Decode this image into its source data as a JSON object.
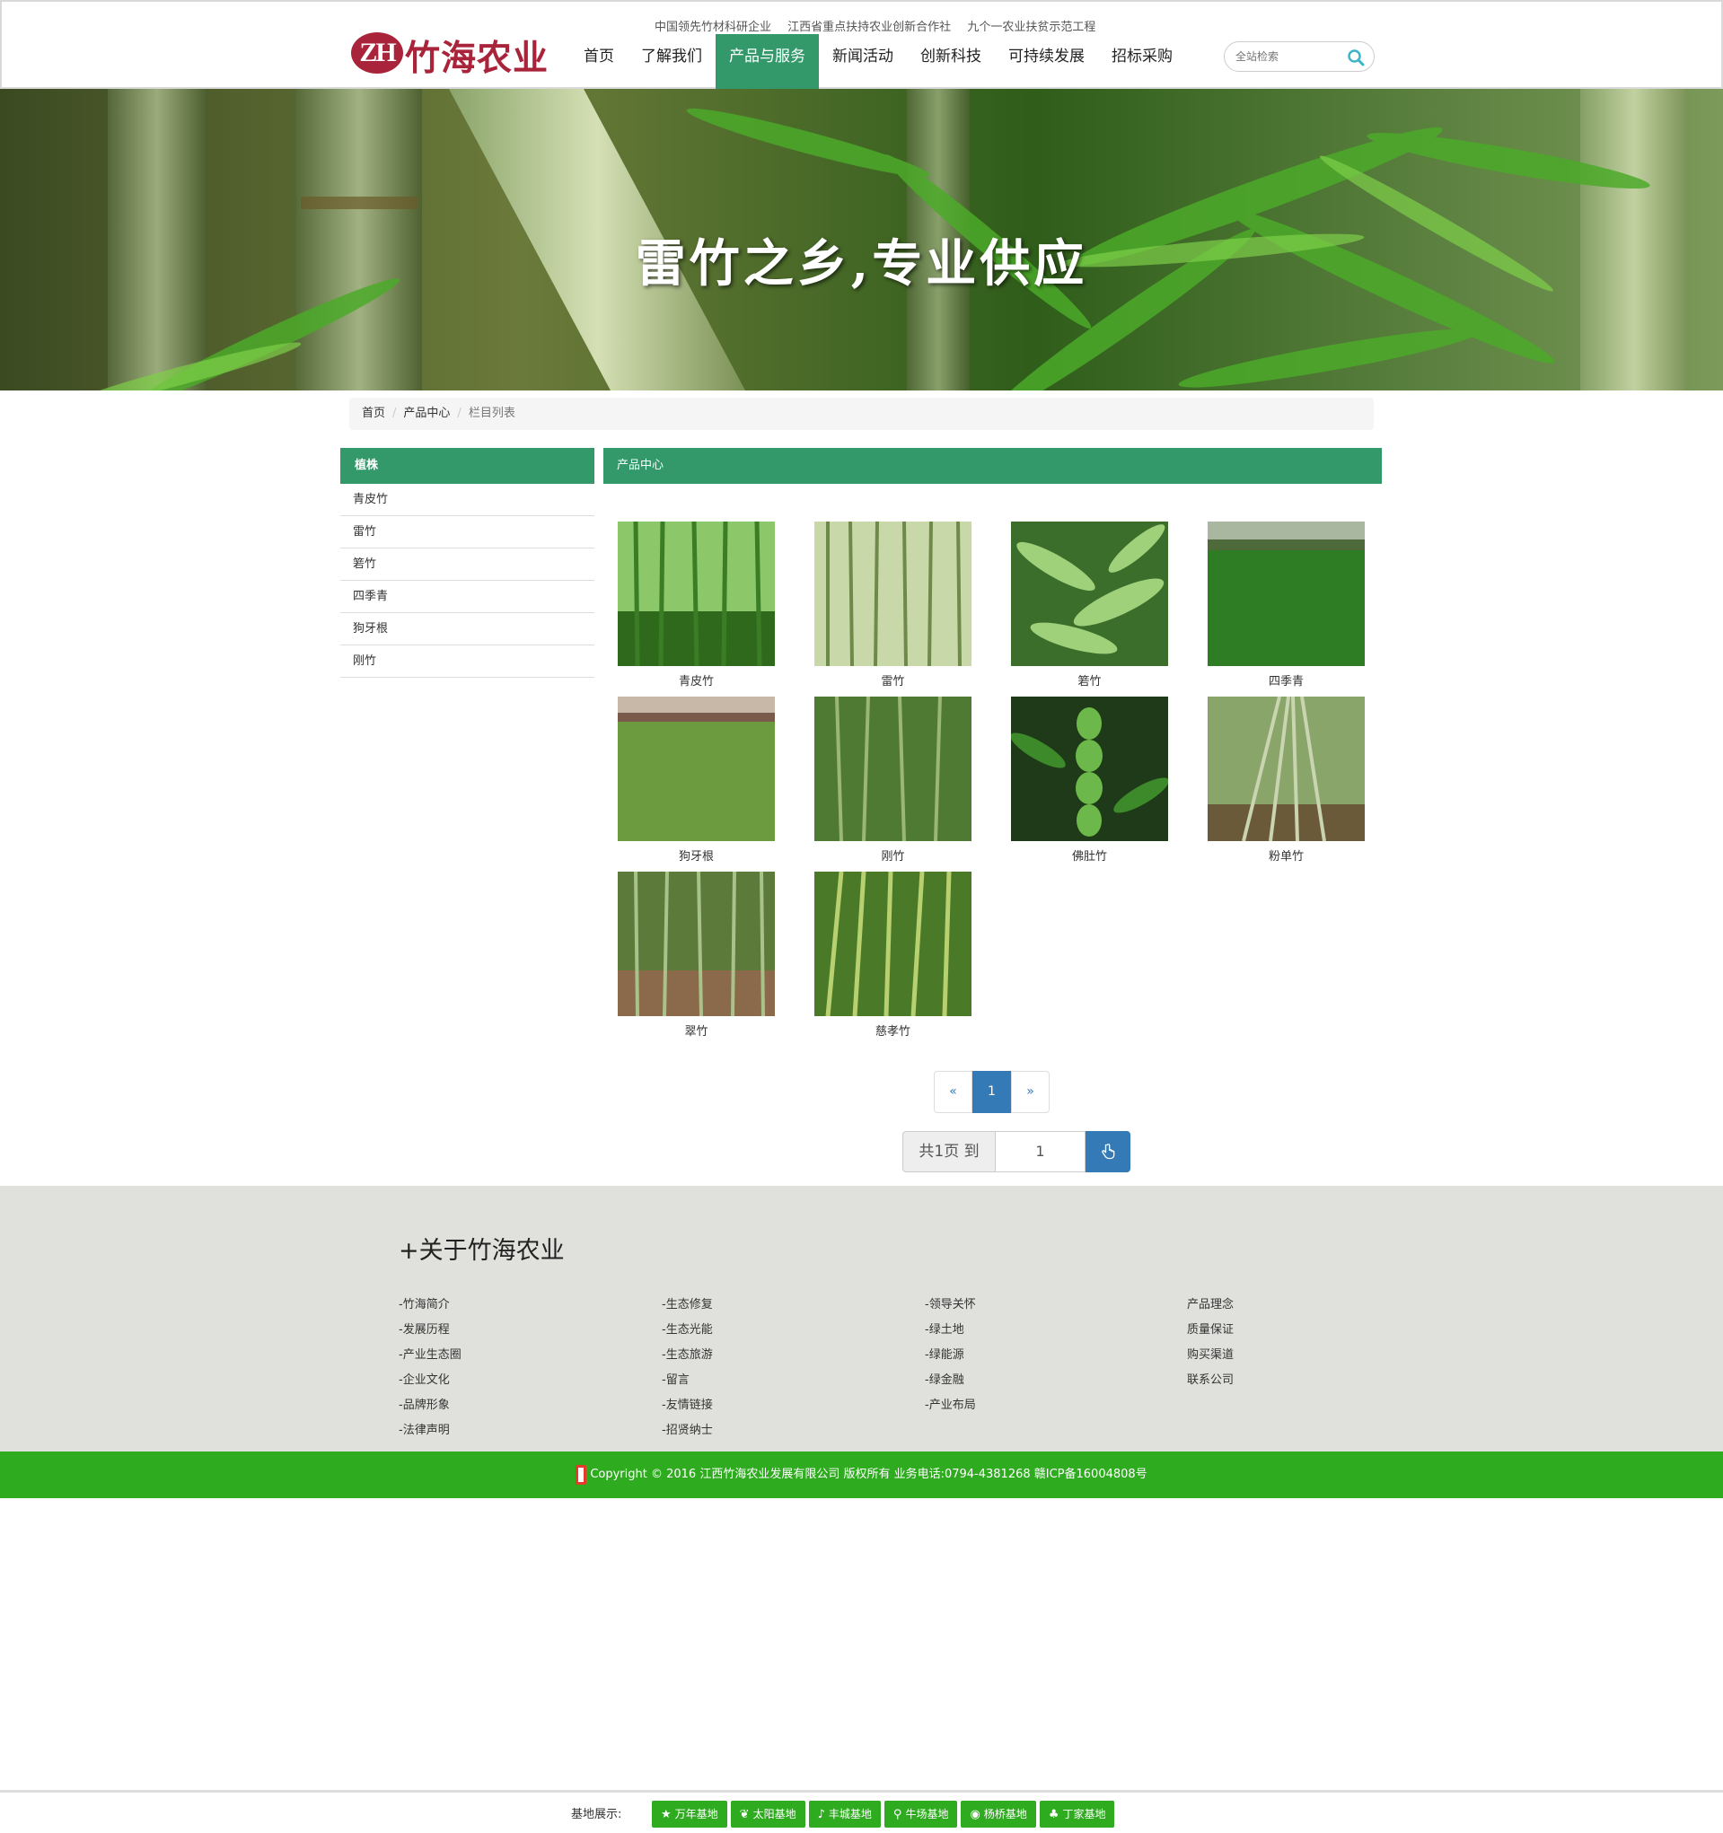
{
  "header": {
    "logo_abbr": "ZH",
    "logo_text": "竹海农业",
    "taglines": [
      "中国领先竹材科研企业",
      "江西省重点扶持农业创新合作社",
      "九个一农业扶贫示范工程"
    ],
    "nav": [
      "首页",
      "了解我们",
      "产品与服务",
      "新闻活动",
      "创新科技",
      "可持续发展",
      "招标采购"
    ],
    "active_nav": "产品与服务",
    "search_placeholder": "全站检索"
  },
  "banner": {
    "slogan": "雷竹之乡,专业供应"
  },
  "breadcrumb": [
    "首页",
    "产品中心",
    "栏目列表"
  ],
  "sidebar": {
    "title": "植株",
    "items": [
      "青皮竹",
      "雷竹",
      "箬竹",
      "四季青",
      "狗牙根",
      "刚竹"
    ]
  },
  "main": {
    "title": "产品中心",
    "products": [
      {
        "name": "青皮竹"
      },
      {
        "name": "雷竹"
      },
      {
        "name": "箬竹"
      },
      {
        "name": "四季青"
      },
      {
        "name": "狗牙根"
      },
      {
        "name": "刚竹"
      },
      {
        "name": "佛肚竹"
      },
      {
        "name": "粉单竹"
      },
      {
        "name": "翠竹"
      },
      {
        "name": "慈孝竹"
      }
    ]
  },
  "pagination": {
    "prev": "«",
    "current": "1",
    "next": "»",
    "jump_label": "共1页 到",
    "jump_value": "1"
  },
  "footer": {
    "title": "+关于竹海农业",
    "columns": [
      [
        "-竹海简介",
        "-发展历程",
        "-产业生态圈",
        "-企业文化",
        "-品牌形象",
        "-法律声明"
      ],
      [
        "-生态修复",
        "-生态光能",
        "-生态旅游",
        "-留言",
        "-友情链接",
        "-招贤纳士"
      ],
      [
        "-领导关怀",
        "-绿土地",
        "-绿能源",
        "-绿金融",
        "-产业布局"
      ],
      [
        "产品理念",
        "质量保证",
        "购买渠道",
        "联系公司"
      ]
    ],
    "copyright": "Copyright © 2016 江西竹海农业发展有限公司 版权所有 业务电话:0794-4381268 赣ICP备16004808号"
  },
  "bottom_bar": {
    "label": "基地展示:",
    "buttons": [
      {
        "label": "万年基地",
        "icon": "star-icon",
        "glyph": "★"
      },
      {
        "label": "太阳基地",
        "icon": "leaf-icon",
        "glyph": "❦"
      },
      {
        "label": "丰城基地",
        "icon": "bell-icon",
        "glyph": "♪"
      },
      {
        "label": "牛场基地",
        "icon": "map-marker-icon",
        "glyph": "⚲"
      },
      {
        "label": "杨桥基地",
        "icon": "globe-icon",
        "glyph": "◉"
      },
      {
        "label": "丁家基地",
        "icon": "tree-icon",
        "glyph": "♣"
      }
    ]
  },
  "colors": {
    "brand_red": "#a9243a",
    "nav_green": "#33996b",
    "footer_green": "#2eab1f",
    "pager_blue": "#337ab7"
  }
}
